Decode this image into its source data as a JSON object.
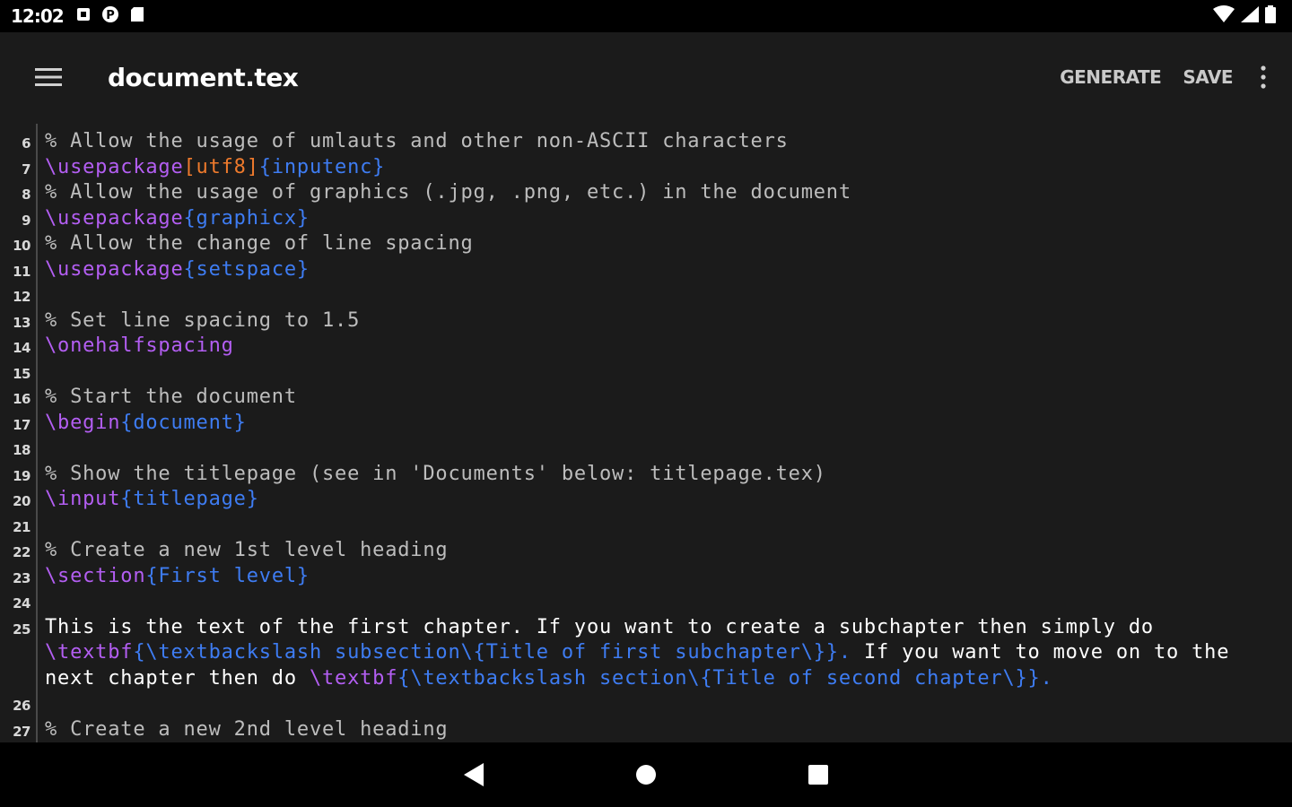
{
  "status": {
    "time": "12:02",
    "left_icons": [
      "notification-icon",
      "p-icon",
      "sd-card-icon"
    ],
    "right_icons": [
      "wifi-icon",
      "cell-signal-icon",
      "battery-icon"
    ]
  },
  "appbar": {
    "title": "document.tex",
    "menu_icon": "menu-icon",
    "actions": [
      "GENERATE",
      "SAVE"
    ],
    "overflow_icon": "more-vert-icon"
  },
  "editor": {
    "lines": [
      {
        "num": "6",
        "segments": [
          {
            "type": "comment",
            "text": "% Allow the usage of umlauts and other non-ASCII characters"
          }
        ]
      },
      {
        "num": "7",
        "segments": [
          {
            "type": "cmd",
            "text": "\\usepackage"
          },
          {
            "type": "opt",
            "text": "[utf8]"
          },
          {
            "type": "arg",
            "text": "{inputenc}"
          }
        ]
      },
      {
        "num": "8",
        "segments": [
          {
            "type": "comment",
            "text": "% Allow the usage of graphics (.jpg, .png, etc.) in the document"
          }
        ]
      },
      {
        "num": "9",
        "segments": [
          {
            "type": "cmd",
            "text": "\\usepackage"
          },
          {
            "type": "arg",
            "text": "{graphicx}"
          }
        ]
      },
      {
        "num": "10",
        "segments": [
          {
            "type": "comment",
            "text": "% Allow the change of line spacing"
          }
        ]
      },
      {
        "num": "11",
        "segments": [
          {
            "type": "cmd",
            "text": "\\usepackage"
          },
          {
            "type": "arg",
            "text": "{setspace}"
          }
        ]
      },
      {
        "num": "12",
        "segments": []
      },
      {
        "num": "13",
        "segments": [
          {
            "type": "comment",
            "text": "% Set line spacing to 1.5"
          }
        ]
      },
      {
        "num": "14",
        "segments": [
          {
            "type": "cmd",
            "text": "\\onehalfspacing"
          }
        ]
      },
      {
        "num": "15",
        "segments": []
      },
      {
        "num": "16",
        "segments": [
          {
            "type": "comment",
            "text": "% Start the document"
          }
        ]
      },
      {
        "num": "17",
        "segments": [
          {
            "type": "cmd",
            "text": "\\begin"
          },
          {
            "type": "arg",
            "text": "{document}"
          }
        ]
      },
      {
        "num": "18",
        "segments": []
      },
      {
        "num": "19",
        "segments": [
          {
            "type": "comment",
            "text": "% Show the titlepage (see in 'Documents' below: titlepage.tex)"
          }
        ]
      },
      {
        "num": "20",
        "segments": [
          {
            "type": "cmd",
            "text": "\\input"
          },
          {
            "type": "arg",
            "text": "{titlepage}"
          }
        ]
      },
      {
        "num": "21",
        "segments": []
      },
      {
        "num": "22",
        "segments": [
          {
            "type": "comment",
            "text": "% Create a new 1st level heading"
          }
        ]
      },
      {
        "num": "23",
        "segments": [
          {
            "type": "cmd",
            "text": "\\section"
          },
          {
            "type": "arg",
            "text": "{First level}"
          }
        ]
      },
      {
        "num": "24",
        "segments": []
      },
      {
        "num": "25",
        "segments": [
          {
            "type": "text",
            "text": "This is the text of the first chapter. If you want to create a subchapter then simply do "
          },
          {
            "type": "cmd",
            "text": "\\textbf"
          },
          {
            "type": "arg",
            "text": "{\\textbackslash subsection\\{Title of first subchapter\\}}."
          },
          {
            "type": "text",
            "text": " If you want to move on to the next chapter then do "
          },
          {
            "type": "cmd",
            "text": "\\textbf"
          },
          {
            "type": "arg",
            "text": "{\\textbackslash section\\{Title of second chapter\\}}."
          }
        ]
      },
      {
        "num": "26",
        "segments": []
      },
      {
        "num": "27",
        "segments": [
          {
            "type": "comment",
            "text": "% Create a new 2nd level heading"
          }
        ]
      }
    ]
  },
  "navbar": {
    "buttons": [
      "back-icon",
      "home-icon",
      "recents-icon"
    ]
  }
}
